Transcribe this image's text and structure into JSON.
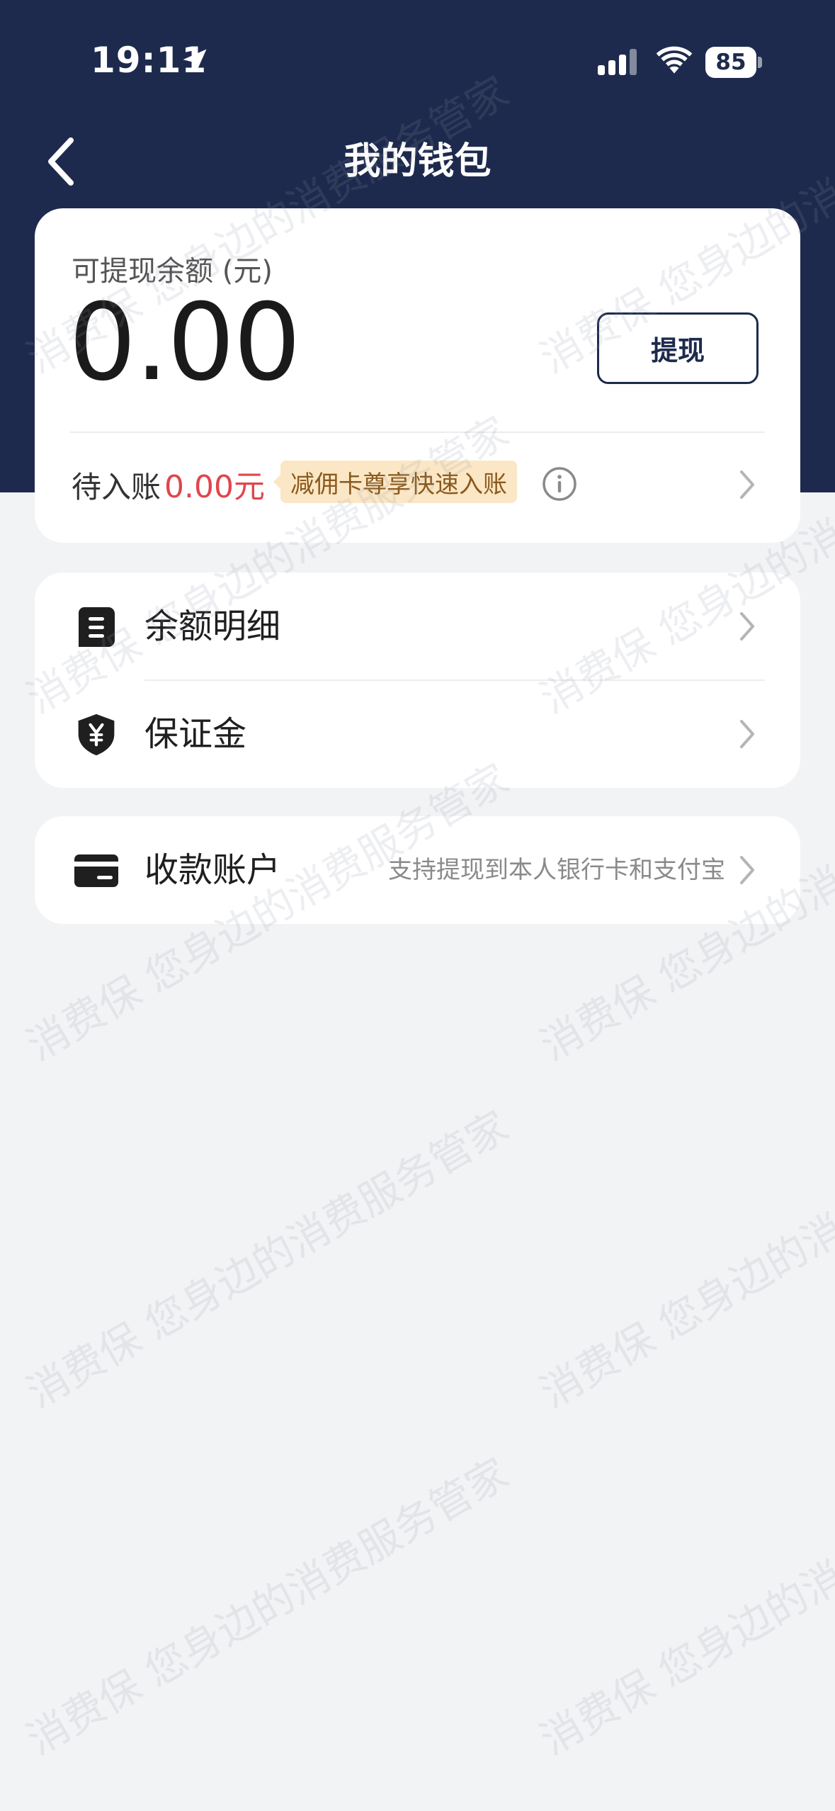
{
  "status_bar": {
    "time": "19:11",
    "battery": "85"
  },
  "nav": {
    "title": "我的钱包"
  },
  "balance": {
    "label": "可提现余额 (元)",
    "amount": "0.00",
    "withdraw_label": "提现",
    "pending_label": "待入账",
    "pending_amount": "0.00元",
    "promo_tag": "减佣卡尊享快速入账"
  },
  "menu": {
    "items": [
      {
        "label": "余额明细",
        "icon": "document-icon"
      },
      {
        "label": "保证金",
        "icon": "shield-yuan-icon"
      }
    ]
  },
  "account": {
    "label": "收款账户",
    "hint": "支持提现到本人银行卡和支付宝",
    "icon": "card-icon"
  },
  "watermark": {
    "text_a": "消费保 您身边的消费服务管家"
  },
  "colors": {
    "header": "#1e2a4d",
    "accent_red": "#e0464d",
    "tag_bg": "#fbe7c5",
    "tag_text": "#8b5a1d"
  }
}
